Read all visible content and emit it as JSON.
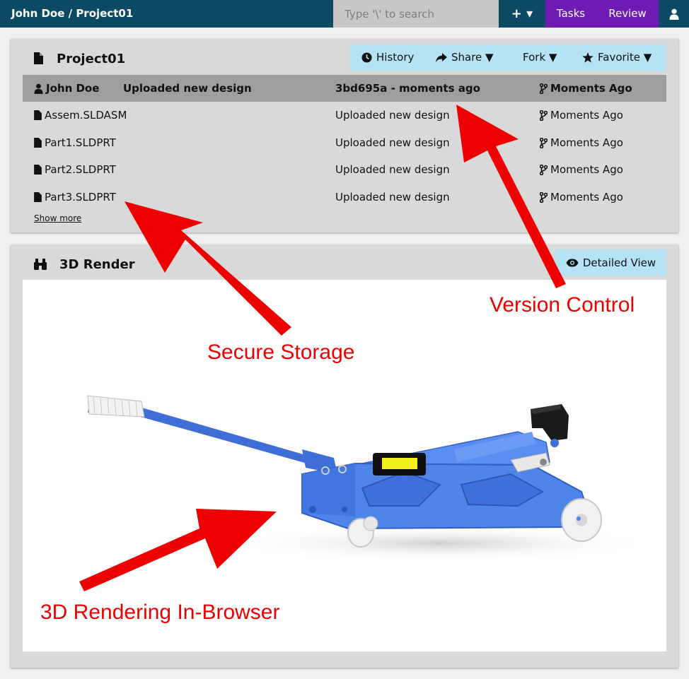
{
  "topbar": {
    "breadcrumb": "John Doe / Project01",
    "search_placeholder": "Type '\\' to search",
    "new_label": "+ ▾",
    "tasks_label": "Tasks",
    "review_label": "Review"
  },
  "project_panel": {
    "title": "Project01",
    "actions": {
      "history": "History",
      "share": "Share ▼",
      "fork": "Fork ▼",
      "favorite": "Favorite ▼"
    },
    "commit": {
      "author": "John Doe",
      "message": "Uploaded new design",
      "hash_time": "3bd695a - moments ago",
      "branch_time": "Moments Ago"
    },
    "files": [
      {
        "name": "Assem.SLDASM",
        "message": "Uploaded new design",
        "time": "Moments Ago"
      },
      {
        "name": "Part1.SLDPRT",
        "message": "Uploaded new design",
        "time": "Moments Ago"
      },
      {
        "name": "Part2.SLDPRT",
        "message": "Uploaded new design",
        "time": "Moments Ago"
      },
      {
        "name": "Part3.SLDPRT",
        "message": "Uploaded new design",
        "time": "Moments Ago"
      }
    ],
    "show_more": "Show more"
  },
  "render_panel": {
    "title": "3D Render",
    "detailed_view": "Detailed View"
  },
  "annotations": {
    "version_control": "Version Control",
    "secure_storage": "Secure Storage",
    "rendering": "3D Rendering In-Browser"
  },
  "colors": {
    "topbar": "#0c4a63",
    "purple": "#6e1bb3",
    "action_bar": "#b6e3f4",
    "annotation": "#ee0000",
    "jack_blue": "#4f84e8"
  }
}
